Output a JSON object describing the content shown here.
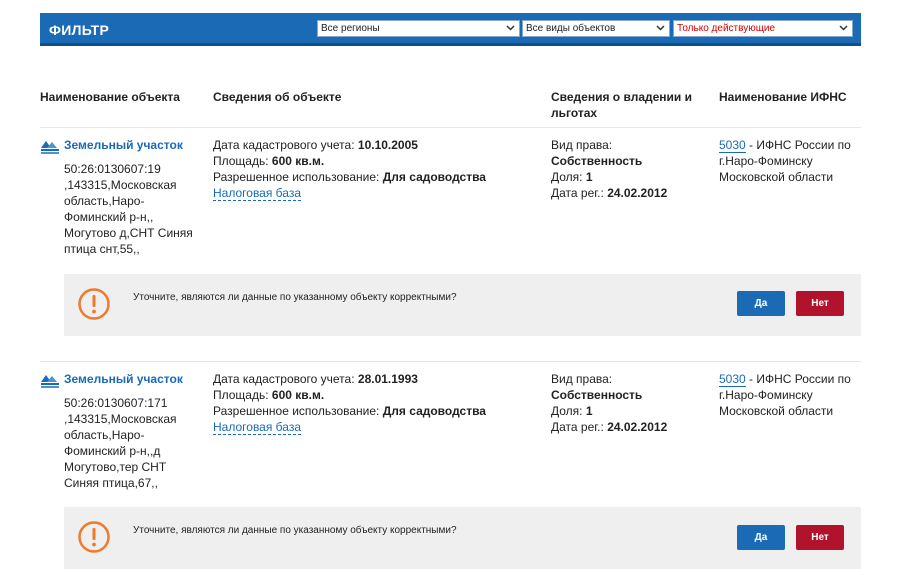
{
  "filter": {
    "title": "ФИЛЬТР",
    "region": "Все регионы",
    "object_type": "Все виды объектов",
    "status": "Только действующие",
    "status_color": "#d40000",
    "accent": "#1a6ab5"
  },
  "headers": {
    "name": "Наименование объекта",
    "info": "Сведения об объекте",
    "ownership_1": "Сведения о владении и",
    "ownership_2": "льготах",
    "ifns": "Наименование ИФНС"
  },
  "objects": [
    {
      "name": "Земельный участок",
      "address_lines": [
        "50:26:0130607:19",
        ",143315,Московская",
        "область,Наро-",
        "Фоминский р-н,,",
        "Могутово д,СНТ Синяя",
        "птица снт,55,,"
      ],
      "cadastral_label": "Дата кадастрового учета:",
      "cadastral_date": "10.10.2005",
      "area_label": "Площадь:",
      "area": "600 кв.м.",
      "use_label": "Разрешенное использование:",
      "use": "Для садоводства",
      "tax_base": "Налоговая база",
      "right_label": "Вид права:",
      "right": "Собственность",
      "share_label": "Доля:",
      "share": "1",
      "reg_label": "Дата рег.:",
      "reg_date": "24.02.2012",
      "ifns_code": "5030",
      "ifns_line1": " - ИФНС России по",
      "ifns_line2": "г.Наро-Фоминску",
      "ifns_line3": "Московской области",
      "confirm_text": "Уточните, являются ли данные по указанному объекту корректными?",
      "yes": "Да",
      "no": "Нет"
    },
    {
      "name": "Земельный участок",
      "address_lines": [
        "50:26:0130607:171",
        ",143315,Московская",
        "область,Наро-",
        "Фоминский р-н,,д",
        "Могутово,тер СНТ",
        "Синяя птица,67,,"
      ],
      "cadastral_label": "Дата кадастрового учета:",
      "cadastral_date": "28.01.1993",
      "area_label": "Площадь:",
      "area": "600 кв.м.",
      "use_label": "Разрешенное использование:",
      "use": "Для садоводства",
      "tax_base": "Налоговая база",
      "right_label": "Вид права:",
      "right": "Собственность",
      "share_label": "Доля:",
      "share": "1",
      "reg_label": "Дата рег.:",
      "reg_date": "24.02.2012",
      "ifns_code": "5030",
      "ifns_line1": " - ИФНС России по",
      "ifns_line2": "г.Наро-Фоминску",
      "ifns_line3": "Московской области",
      "confirm_text": "Уточните, являются ли данные по указанному объекту корректными?",
      "yes": "Да",
      "no": "Нет"
    }
  ]
}
